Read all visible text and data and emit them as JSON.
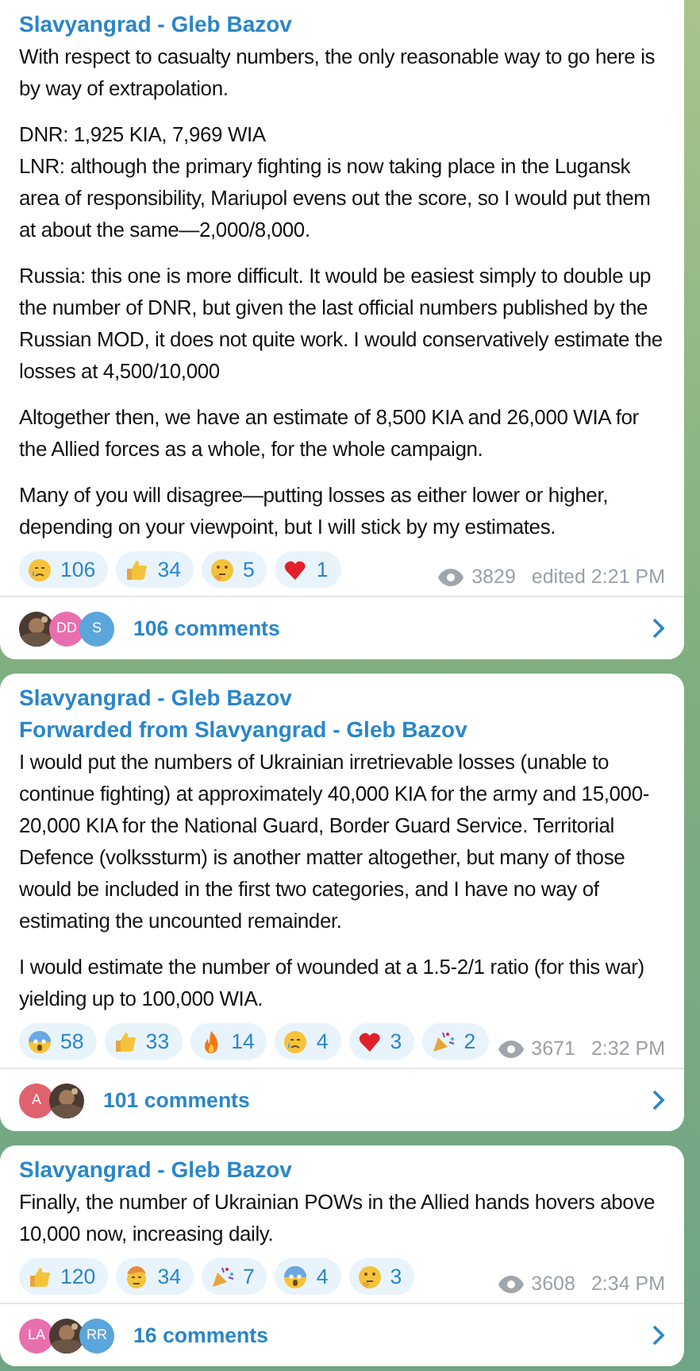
{
  "posts": [
    {
      "author": "Slavyangrad - Gleb Bazov",
      "blocks": [
        [
          "With respect to casualty numbers, the only reasonable way to go here is by way of extrapolation."
        ],
        [
          "DNR: 1,925 KIA, 7,969 WIA",
          "LNR: although the primary fighting is now taking place in the Lugansk area of responsibility, Mariupol evens out the score, so I would put them at about the same—2,000/8,000."
        ],
        [
          "Russia: this one is more difficult. It would be easiest simply to double up the number of DNR, but given the last official numbers published by the Russian MOD, it does not quite work. I would conservatively estimate the losses at 4,500/10,000"
        ],
        [
          "Altogether then, we have an estimate of 8,500 KIA and 26,000 WIA for the Allied forces as a whole, for the whole campaign."
        ],
        [
          "Many of you will disagree—putting losses as either lower or higher, depending on your viewpoint, but I will stick by my estimates."
        ]
      ],
      "reactions": [
        {
          "kind": "cry",
          "count": "106"
        },
        {
          "kind": "thumbs",
          "count": "34"
        },
        {
          "kind": "thinking",
          "count": "5"
        },
        {
          "kind": "heart",
          "count": "1"
        }
      ],
      "views": "3829",
      "time": "edited 2:21 PM",
      "avatars": [
        {
          "kind": "picture"
        },
        {
          "kind": "letters",
          "text": "DD",
          "color": "#e86fae"
        },
        {
          "kind": "letters",
          "text": "S",
          "color": "#5aa5dc"
        }
      ],
      "comments": "106 comments"
    },
    {
      "author": "Slavyangrad - Gleb Bazov",
      "forwarded": "Forwarded from Slavyangrad - Gleb Bazov",
      "blocks": [
        [
          "I would put the numbers of Ukrainian irretrievable losses (unable to continue fighting) at approximately 40,000 KIA for the army and 15,000-20,000 KIA for the National Guard, Border Guard Service. Territorial Defence (volkssturm) is another matter altogether, but many of those would be included in the first two categories, and I have no way of estimating the uncounted remainder."
        ],
        [
          "I would estimate the number of wounded at a 1.5-2/1 ratio (for this war) yielding up to 100,000 WIA."
        ]
      ],
      "reactions": [
        {
          "kind": "scream",
          "count": "58"
        },
        {
          "kind": "thumbs",
          "count": "33"
        },
        {
          "kind": "fire",
          "count": "14"
        },
        {
          "kind": "cry",
          "count": "4"
        },
        {
          "kind": "heart",
          "count": "3"
        },
        {
          "kind": "party",
          "count": "2"
        }
      ],
      "views": "3671",
      "time": "2:32 PM",
      "avatars": [
        {
          "kind": "letters",
          "text": "A",
          "color": "#e0626e"
        },
        {
          "kind": "picture"
        }
      ],
      "comments": "101 comments"
    },
    {
      "author": "Slavyangrad - Gleb Bazov",
      "blocks": [
        [
          "Finally, the number of Ukrainian POWs in the Allied hands hovers above 10,000 now, increasing daily."
        ]
      ],
      "reactions": [
        {
          "kind": "thumbs",
          "count": "120"
        },
        {
          "kind": "exploding",
          "count": "34"
        },
        {
          "kind": "party",
          "count": "7"
        },
        {
          "kind": "scream",
          "count": "4"
        },
        {
          "kind": "thinking",
          "count": "3"
        }
      ],
      "views": "3608",
      "time": "2:34 PM",
      "avatars": [
        {
          "kind": "letters",
          "text": "LA",
          "color": "#e86fae"
        },
        {
          "kind": "picture"
        },
        {
          "kind": "letters",
          "text": "RR",
          "color": "#5aa5dc"
        }
      ],
      "comments": "16 comments"
    }
  ]
}
